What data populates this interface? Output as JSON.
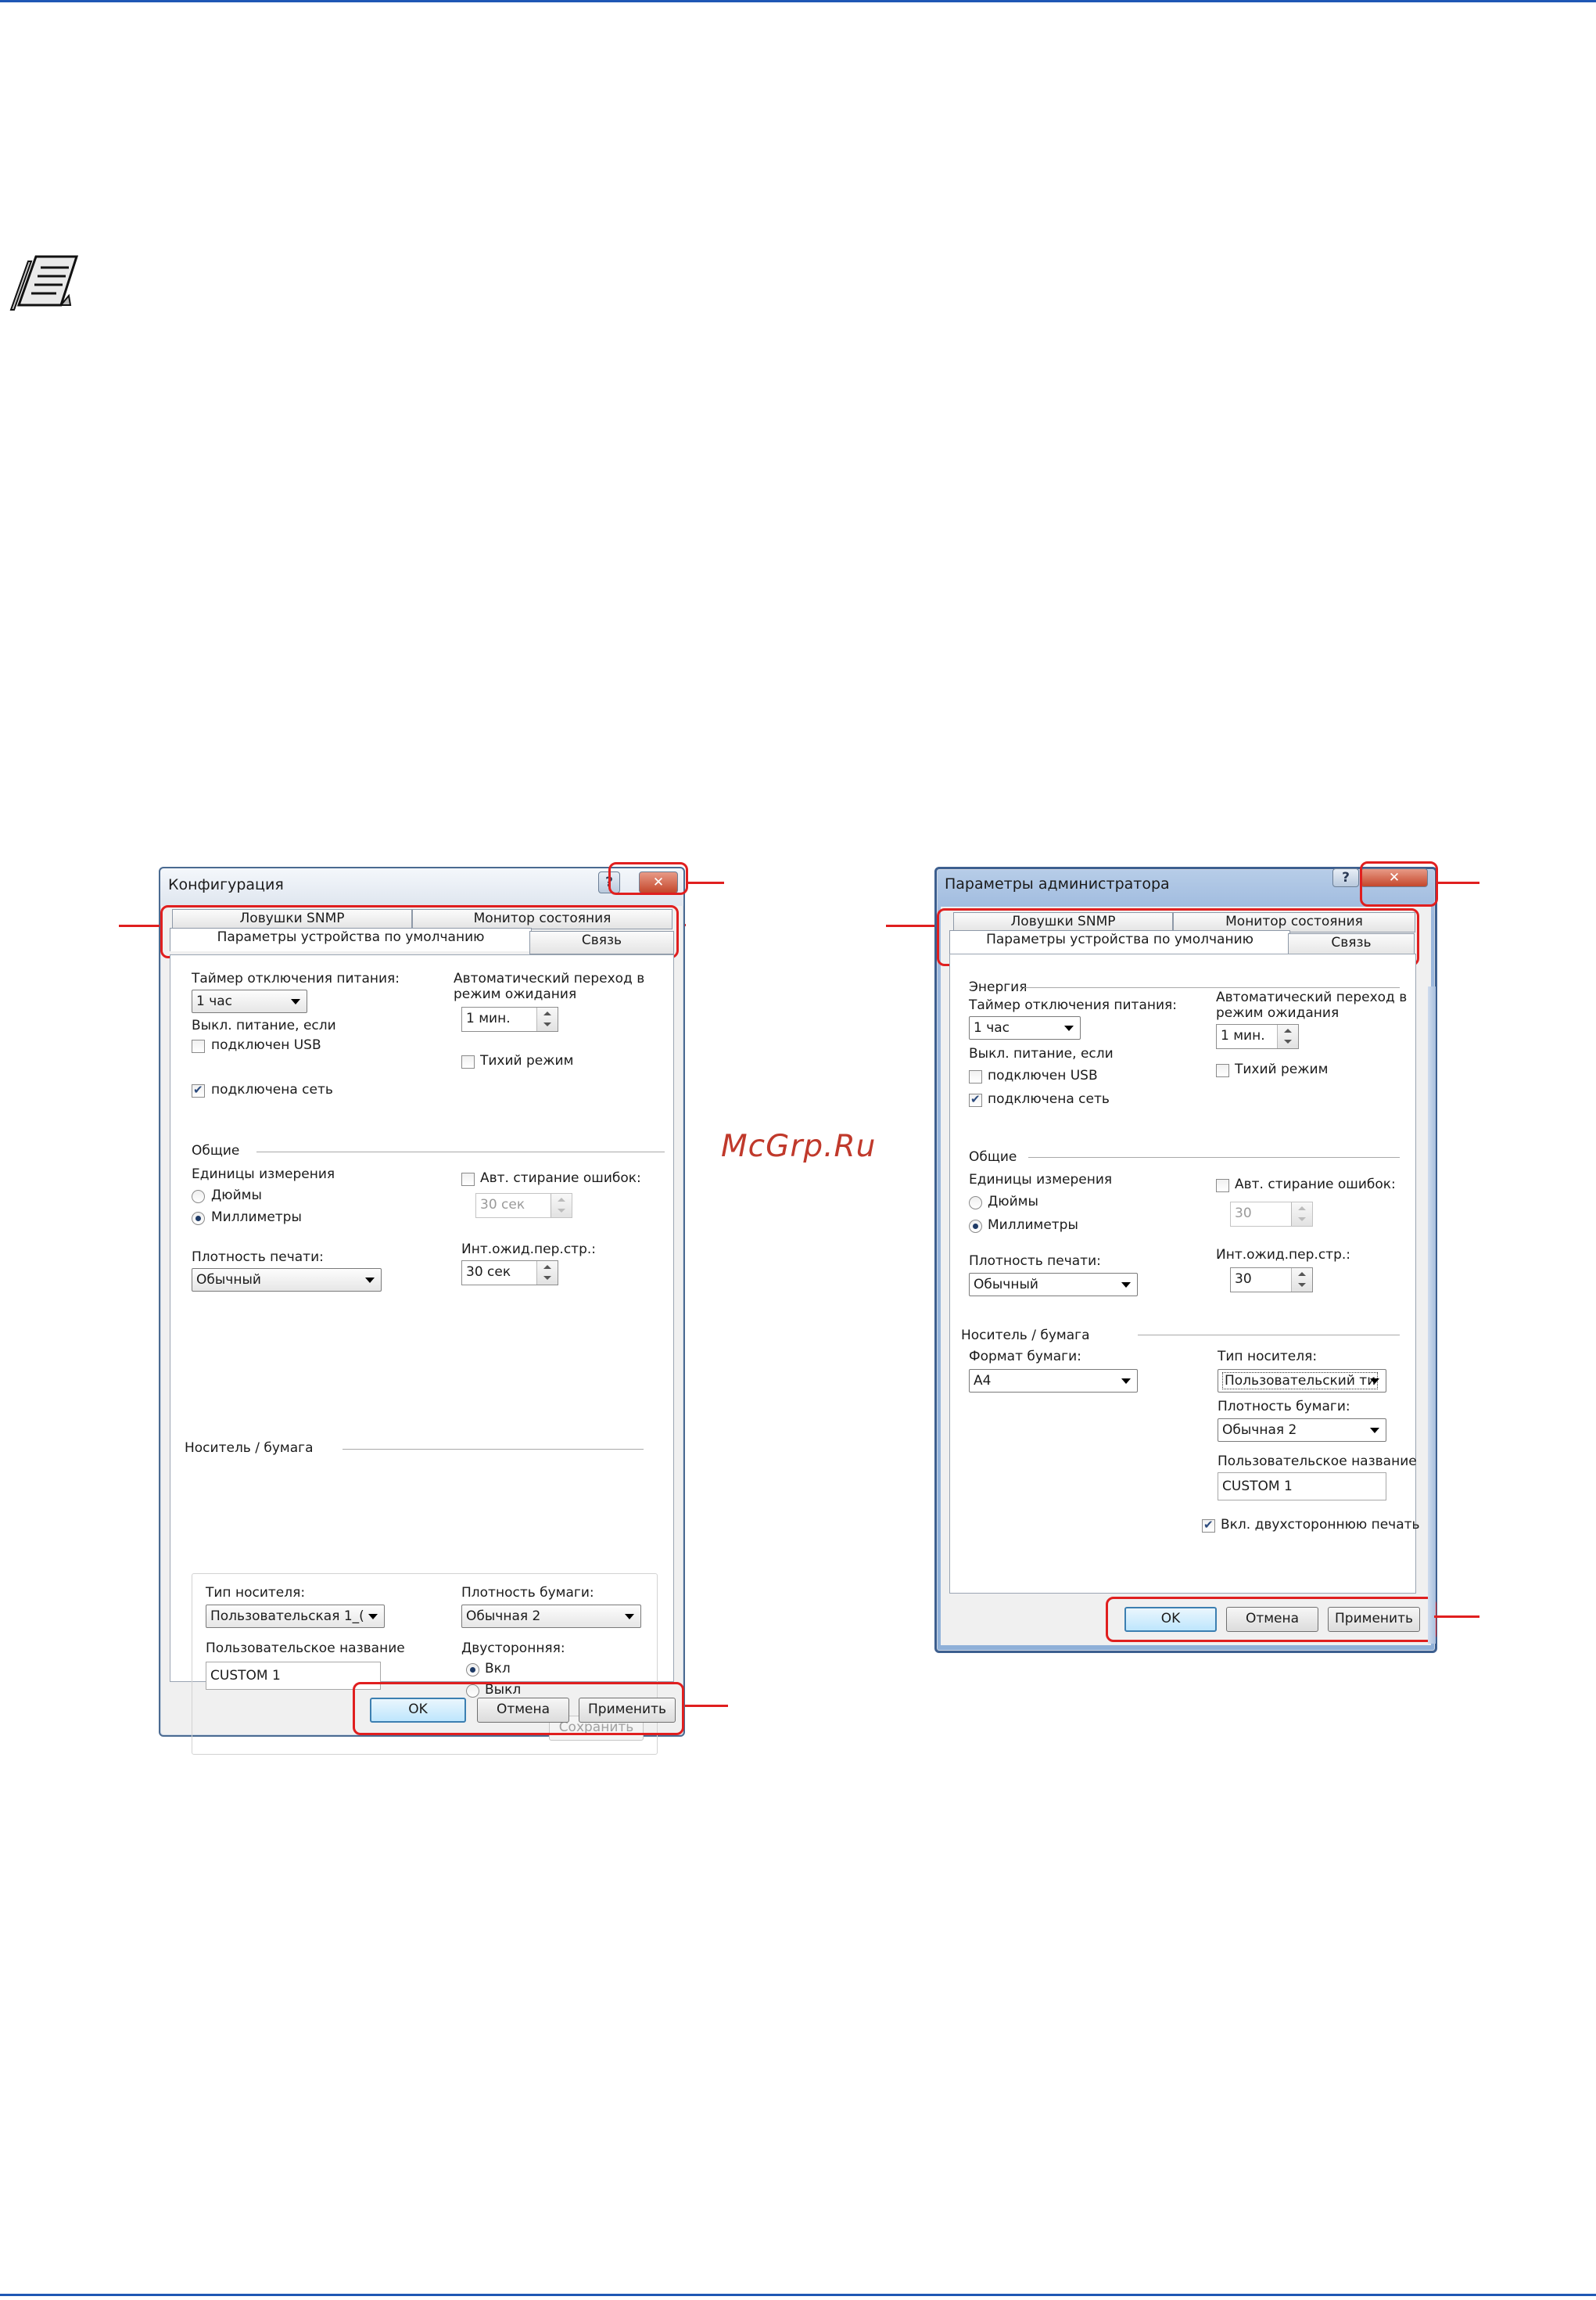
{
  "watermark": "McGrp.Ru",
  "dialog_left": {
    "title": "Конфигурация",
    "help_glyph": "?",
    "close_glyph": "✕",
    "tabs": [
      "Ловушки SNMP",
      "Монитор состояния",
      "Параметры устройства по умолчанию",
      "Связь"
    ],
    "power_timer_label": "Таймер отключения питания:",
    "power_timer_value": "1 час",
    "power_off_if_label": "Выкл. питание, если",
    "usb_label": "подключен USB",
    "usb_checked": false,
    "network_label": "подключена сеть",
    "network_checked": true,
    "auto_sleep_label_1": "Автоматический переход в",
    "auto_sleep_label_2": "режим ожидания",
    "auto_sleep_value": "1 мин.",
    "quiet_mode_label": "Тихий режим",
    "quiet_mode_checked": false,
    "general_section": "Общие",
    "units_label": "Единицы измерения",
    "inches_label": "Дюймы",
    "mm_label": "Миллиметры",
    "selected_unit": "mm",
    "auto_error_clear_label": "Авт. стирание ошибок:",
    "auto_error_clear_checked": false,
    "auto_error_clear_value": "30 сек",
    "print_density_label": "Плотность печати:",
    "print_density_value": "Обычный",
    "page_timeout_label": "Инт.ожид.пер.стр.:",
    "page_timeout_value": "30 сек",
    "media_section": "Носитель / бумага",
    "media_type_label": "Тип носителя:",
    "media_type_value": "Пользовательская 1_(",
    "paper_weight_label": "Плотность бумаги:",
    "paper_weight_value": "Обычная 2",
    "custom_name_label": "Пользовательское название",
    "custom_name_value": "CUSTOM 1",
    "duplex_label": "Двусторонняя:",
    "duplex_on_label": "Вкл",
    "duplex_off_label": "Выкл",
    "duplex_selected": "on",
    "save_button": "Сохранить",
    "ok_button": "OK",
    "cancel_button": "Отмена",
    "apply_button": "Применить"
  },
  "dialog_right": {
    "title": "Параметры администратора",
    "help_glyph": "?",
    "close_glyph": "✕",
    "tabs": [
      "Ловушки SNMP",
      "Монитор состояния",
      "Параметры устройства по умолчанию",
      "Связь"
    ],
    "energy_section": "Энергия",
    "power_timer_label": "Таймер отключения питания:",
    "power_timer_value": "1 час",
    "power_off_if_label": "Выкл. питание, если",
    "usb_label": "подключен USB",
    "usb_checked": false,
    "network_label": "подключена сеть",
    "network_checked": true,
    "auto_sleep_label_1": "Автоматический переход в",
    "auto_sleep_label_2": "режим ожидания",
    "auto_sleep_value": "1 мин.",
    "quiet_mode_label": "Тихий режим",
    "quiet_mode_checked": false,
    "general_section": "Общие",
    "units_label": "Единицы измерения",
    "inches_label": "Дюймы",
    "mm_label": "Миллиметры",
    "selected_unit": "mm",
    "auto_error_clear_label": "Авт. стирание ошибок:",
    "auto_error_clear_checked": false,
    "auto_error_clear_value": "30",
    "print_density_label": "Плотность печати:",
    "print_density_value": "Обычный",
    "page_timeout_label": "Инт.ожид.пер.стр.:",
    "page_timeout_value": "30",
    "media_section": "Носитель / бумага",
    "paper_size_label": "Формат бумаги:",
    "paper_size_value": "A4",
    "media_type_label": "Тип носителя:",
    "media_type_value": "Пользовательский ти",
    "paper_weight_label": "Плотность бумаги:",
    "paper_weight_value": "Обычная 2",
    "custom_name_label": "Пользовательское название",
    "custom_name_value": "CUSTOM 1",
    "duplex_enable_label": "Вкл. двухстороннюю печать",
    "duplex_enable_checked": true,
    "ok_button": "OK",
    "cancel_button": "Отмена",
    "apply_button": "Применить"
  }
}
